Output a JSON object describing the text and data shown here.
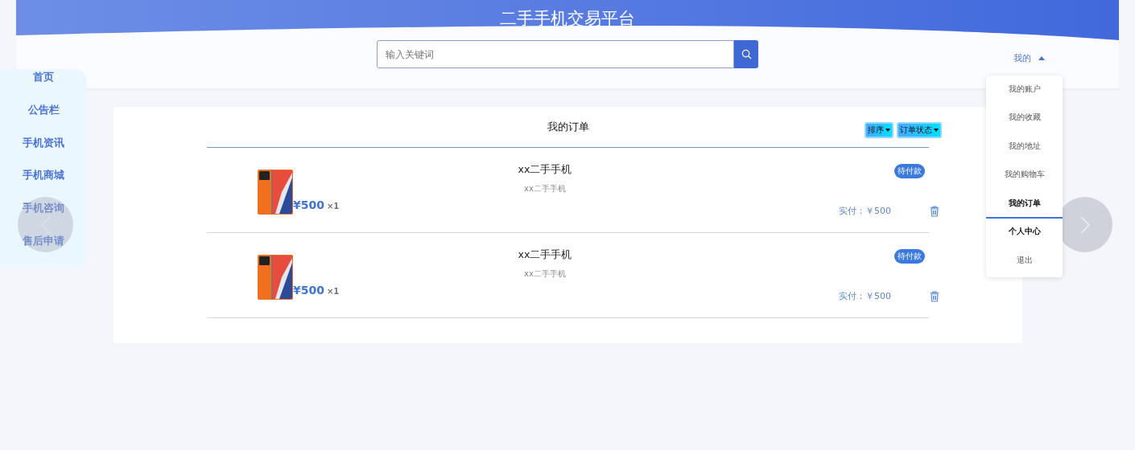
{
  "header": {
    "title": "二手手机交易平台",
    "search": {
      "placeholder": "输入关键词"
    },
    "user_menu": {
      "label": "我的",
      "expanded": true,
      "items": [
        {
          "label": "我的账户",
          "selected": false,
          "bold": false
        },
        {
          "label": "我的收藏",
          "selected": false,
          "bold": false
        },
        {
          "label": "我的地址",
          "selected": false,
          "bold": false
        },
        {
          "label": "我的购物车",
          "selected": false,
          "bold": false
        },
        {
          "label": "我的订单",
          "selected": true,
          "bold": true
        },
        {
          "label": "个人中心",
          "selected": false,
          "bold": true
        },
        {
          "label": "退出",
          "selected": false,
          "bold": false
        }
      ]
    }
  },
  "sidebar": {
    "items": [
      {
        "label": "首页"
      },
      {
        "label": "公告栏"
      },
      {
        "label": "手机资讯"
      },
      {
        "label": "手机商城"
      },
      {
        "label": "手机咨询"
      },
      {
        "label": "售后申请"
      }
    ]
  },
  "orders": {
    "title": "我的订单",
    "filters": [
      {
        "label": "排序"
      },
      {
        "label": "订单状态"
      }
    ],
    "rows": [
      {
        "price": "¥500",
        "quantity": "×1",
        "name": "xx二手手机",
        "subtitle": "xx二手手机",
        "status": "待付款",
        "paid": "实付：￥500"
      },
      {
        "price": "¥500",
        "quantity": "×1",
        "name": "xx二手手机",
        "subtitle": "xx二手手机",
        "status": "待付款",
        "paid": "实付：￥500"
      }
    ]
  }
}
